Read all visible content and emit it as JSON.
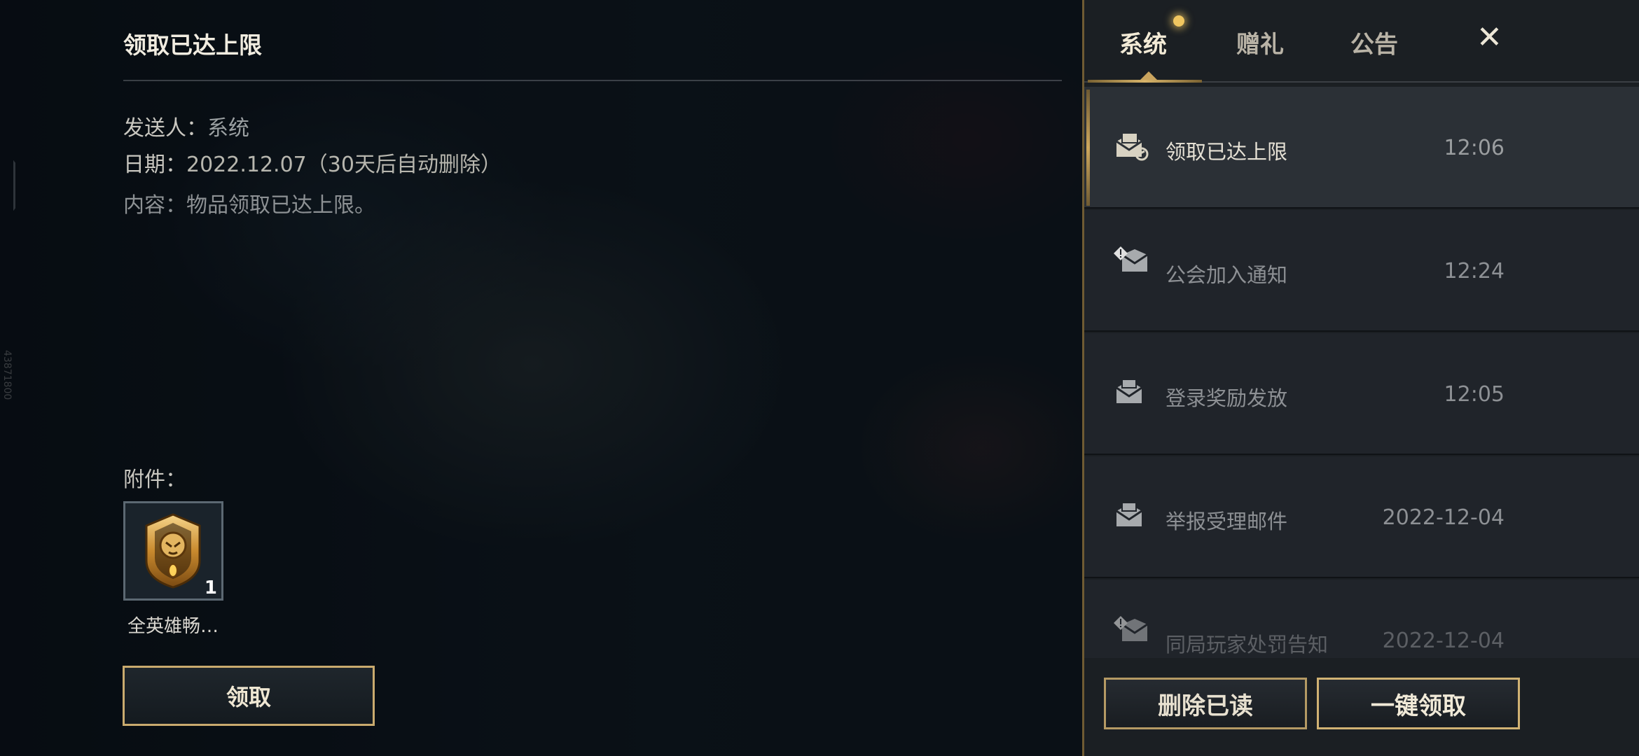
{
  "detail": {
    "title": "领取已达上限",
    "sender_label": "发送人：",
    "sender_value": "系统",
    "date_label": "日期：",
    "date_value": "2022.12.07（30天后自动删除）",
    "content_label": "内容：",
    "content_value": "物品领取已达上限。",
    "attachment_label": "附件：",
    "attachment": {
      "name": "全英雄畅…",
      "count": "1",
      "icon": "hero-shield-icon"
    },
    "claim_button": "领取"
  },
  "side_code": "43871800",
  "panel": {
    "tabs": [
      {
        "label": "系统",
        "active": true,
        "has_dot": true
      },
      {
        "label": "赠礼",
        "active": false
      },
      {
        "label": "公告",
        "active": false
      }
    ],
    "close_glyph": "✕",
    "mails": [
      {
        "title": "领取已达上限",
        "time": "12:06",
        "icon": "mail-read-icon",
        "active": true
      },
      {
        "title": "公会加入通知",
        "time": "12:24",
        "icon": "mail-alert-icon",
        "active": false
      },
      {
        "title": "登录奖励发放",
        "time": "12:05",
        "icon": "mail-icon",
        "active": false
      },
      {
        "title": "举报受理邮件",
        "time": "2022-12-04",
        "icon": "mail-icon",
        "active": false
      },
      {
        "title": "同局玩家处罚告知",
        "time": "2022-12-04",
        "icon": "mail-alert-icon",
        "active": false
      }
    ],
    "delete_read_button": "删除已读",
    "claim_all_button": "一键领取"
  },
  "colors": {
    "accent_gold": "#c9aa6e",
    "panel_bg": "#1b1f23",
    "notification_dot": "#f0c660"
  }
}
